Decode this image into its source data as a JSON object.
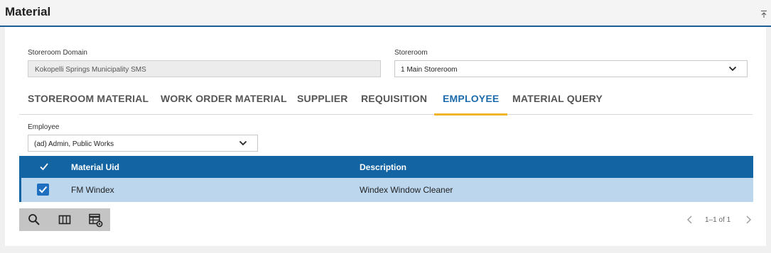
{
  "header": {
    "title": "Material"
  },
  "form": {
    "storeroom_domain": {
      "label": "Storeroom Domain",
      "value": "Kokopelli Springs Municipality SMS"
    },
    "storeroom": {
      "label": "Storeroom",
      "value": "1 Main Storeroom"
    }
  },
  "tabs": [
    {
      "label": "STOREROOM MATERIAL",
      "active": false
    },
    {
      "label": "WORK ORDER MATERIAL",
      "active": false
    },
    {
      "label": "SUPPLIER",
      "active": false
    },
    {
      "label": "REQUISITION",
      "active": false
    },
    {
      "label": "EMPLOYEE",
      "active": true
    },
    {
      "label": "MATERIAL QUERY",
      "active": false
    }
  ],
  "employee": {
    "label": "Employee",
    "value": "(ad) Admin, Public Works"
  },
  "grid": {
    "columns": [
      "Material Uid",
      "Description"
    ],
    "rows": [
      {
        "material_uid": "FM Windex",
        "description": "Windex Window Cleaner",
        "checked": true
      }
    ]
  },
  "toolbar": {
    "icons": [
      "search-icon",
      "columns-icon",
      "grid-settings-icon"
    ]
  },
  "pager": {
    "text": "1–1 of 1"
  },
  "colors": {
    "accent": "#1264a3",
    "tab_underline": "#f0b429",
    "selected_row": "#bcd6ee"
  }
}
